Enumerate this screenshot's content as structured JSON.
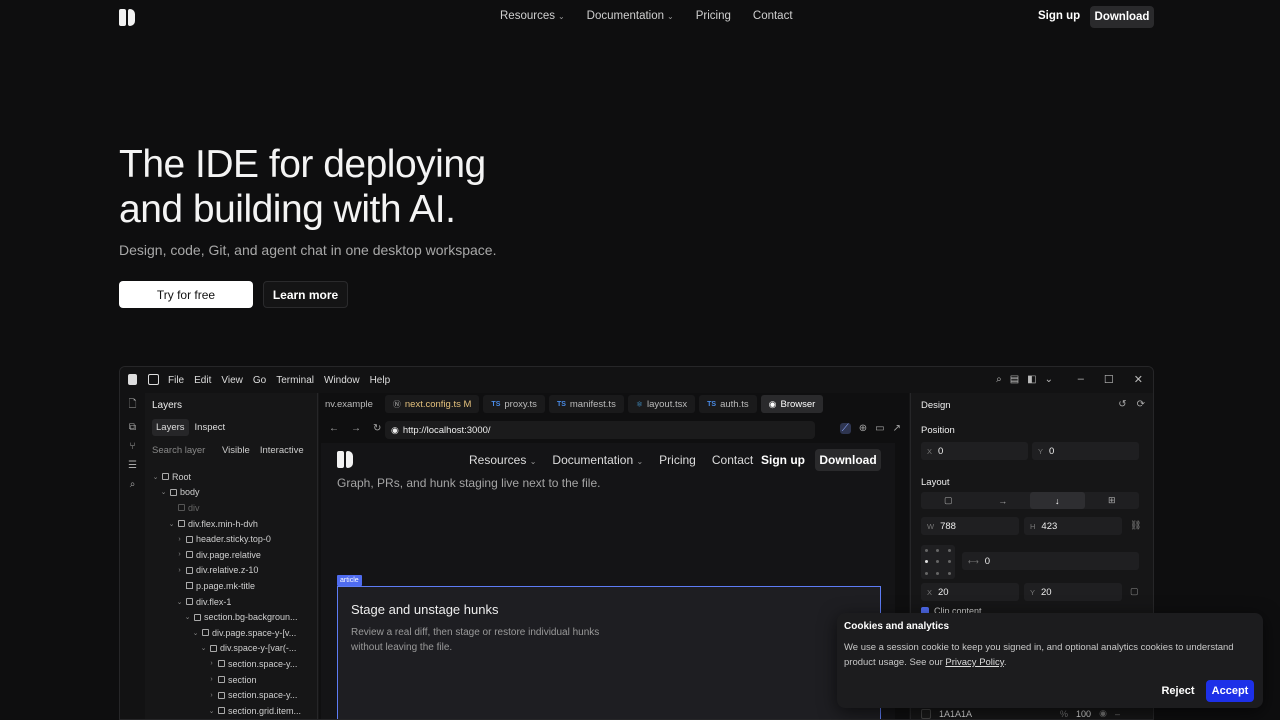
{
  "nav": {
    "items": [
      {
        "label": "Resources",
        "dropdown": true
      },
      {
        "label": "Documentation",
        "dropdown": true
      },
      {
        "label": "Pricing",
        "dropdown": false
      },
      {
        "label": "Contact",
        "dropdown": false
      }
    ],
    "signup": "Sign up",
    "download": "Download"
  },
  "hero": {
    "title_line1": "The IDE for deploying",
    "title_line2": "and building with AI.",
    "subtitle": "Design, code, Git, and agent chat in one desktop workspace.",
    "primary_cta": "Try for free",
    "secondary_cta": "Learn more"
  },
  "app": {
    "menu": [
      "File",
      "Edit",
      "View",
      "Go",
      "Terminal",
      "Window",
      "Help"
    ],
    "layers": {
      "title": "Layers",
      "tabs": [
        "Layers",
        "Inspect"
      ],
      "search_placeholder": "Search layer",
      "filters": [
        "Visible",
        "Interactive"
      ],
      "tree": [
        {
          "label": "Root",
          "depth": 0,
          "arrow": "v"
        },
        {
          "label": "body",
          "depth": 1,
          "arrow": "v"
        },
        {
          "label": "div",
          "depth": 2,
          "arrow": "",
          "dim": true
        },
        {
          "label": "div.flex.min-h-dvh",
          "depth": 2,
          "arrow": "v"
        },
        {
          "label": "header.sticky.top-0",
          "depth": 3,
          "arrow": ">"
        },
        {
          "label": "div.page.relative",
          "depth": 3,
          "arrow": ">"
        },
        {
          "label": "div.relative.z-10",
          "depth": 3,
          "arrow": ">"
        },
        {
          "label": "p.page.mk-title",
          "depth": 3,
          "arrow": "",
          "file": true
        },
        {
          "label": "div.flex-1",
          "depth": 3,
          "arrow": "v"
        },
        {
          "label": "section.bg-backgroun...",
          "depth": 4,
          "arrow": "v"
        },
        {
          "label": "div.page.space-y-[v...",
          "depth": 5,
          "arrow": "v"
        },
        {
          "label": "div.space-y-[var(-...",
          "depth": 6,
          "arrow": "v"
        },
        {
          "label": "section.space-y...",
          "depth": 7,
          "arrow": ">"
        },
        {
          "label": "section",
          "depth": 7,
          "arrow": ">"
        },
        {
          "label": "section.space-y...",
          "depth": 7,
          "arrow": ">"
        },
        {
          "label": "section.grid.item...",
          "depth": 7,
          "arrow": "v"
        }
      ]
    },
    "tabs": [
      {
        "label": "nv.example",
        "kind": "plain"
      },
      {
        "label": "next.config.ts M",
        "kind": "mod"
      },
      {
        "label": "proxy.ts",
        "kind": "ts"
      },
      {
        "label": "manifest.ts",
        "kind": "ts"
      },
      {
        "label": "layout.tsx",
        "kind": "tsx"
      },
      {
        "label": "auth.ts",
        "kind": "ts"
      },
      {
        "label": "Browser",
        "kind": "active"
      }
    ],
    "url": "http://localhost:3000/",
    "preview": {
      "nav": [
        "Resources",
        "Documentation",
        "Pricing",
        "Contact"
      ],
      "signup": "Sign up",
      "download": "Download",
      "subtitle": "Graph, PRs, and hunk staging live next to the file.",
      "badge": "article",
      "card_title": "Stage and unstage hunks",
      "card_body": "Review a real diff, then stage or restore individual hunks without leaving the file."
    },
    "design": {
      "title": "Design",
      "position_label": "Position",
      "x": "0",
      "y": "0",
      "layout_label": "Layout",
      "w": "788",
      "h": "423",
      "gap": "0",
      "pad_x": "20",
      "pad_y": "20",
      "clip_label": "Clip content",
      "fill_hex": "1A1A1A",
      "opacity": "100"
    }
  },
  "cookie": {
    "title": "Cookies and analytics",
    "body": "We use a session cookie to keep you signed in, and optional analytics cookies to understand product usage. See our",
    "link": "Privacy Policy",
    "reject": "Reject",
    "accept": "Accept"
  }
}
